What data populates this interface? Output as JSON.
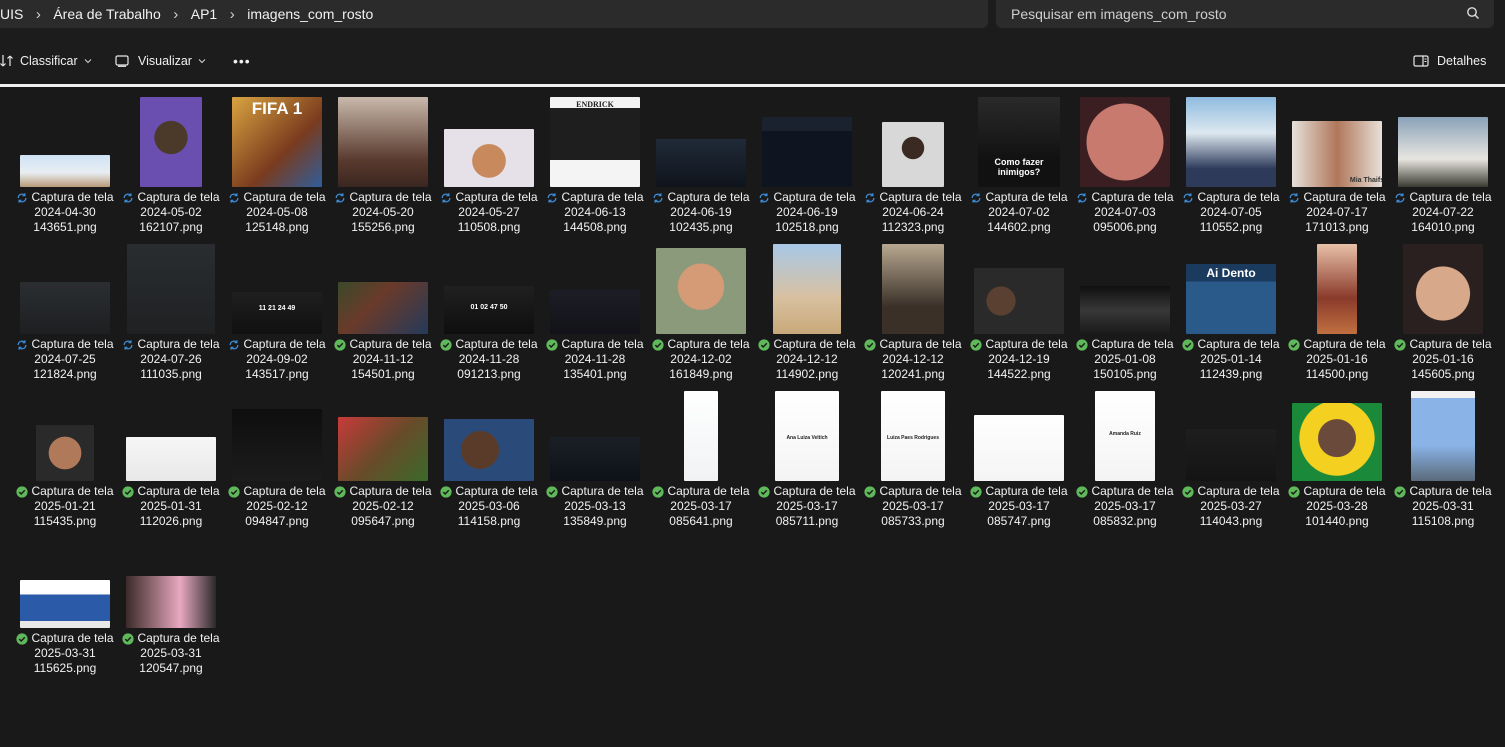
{
  "breadcrumb": {
    "items": [
      "UIS",
      "Área de Trabalho",
      "AP1",
      "imagens_com_rosto"
    ]
  },
  "search": {
    "placeholder": "Pesquisar em imagens_com_rosto"
  },
  "toolbar": {
    "sort_label": "Classificar",
    "view_label": "Visualizar",
    "more_label": "•••",
    "details_label": "Detalhes"
  },
  "colors": {
    "sync_blue": "#3b8ed8",
    "synced_green": "#5fb85a",
    "background": "#191919",
    "bar": "#2b2b2b"
  },
  "files": [
    {
      "line1": "Captura de tela",
      "line2": "2024-04-30",
      "line3": "143651.png",
      "status": "syncing",
      "thumb_text": ""
    },
    {
      "line1": "Captura de tela",
      "line2": "2024-05-02",
      "line3": "162107.png",
      "status": "syncing",
      "thumb_text": ""
    },
    {
      "line1": "Captura de tela",
      "line2": "2024-05-08",
      "line3": "125148.png",
      "status": "syncing",
      "thumb_text": "FIFA 1"
    },
    {
      "line1": "Captura de tela",
      "line2": "2024-05-20",
      "line3": "155256.png",
      "status": "syncing",
      "thumb_text": ""
    },
    {
      "line1": "Captura de tela",
      "line2": "2024-05-27",
      "line3": "110508.png",
      "status": "syncing",
      "thumb_text": ""
    },
    {
      "line1": "Captura de tela",
      "line2": "2024-06-13",
      "line3": "144508.png",
      "status": "syncing",
      "thumb_text": "ENDRICK"
    },
    {
      "line1": "Captura de tela",
      "line2": "2024-06-19",
      "line3": "102435.png",
      "status": "syncing",
      "thumb_text": ""
    },
    {
      "line1": "Captura de tela",
      "line2": "2024-06-19",
      "line3": "102518.png",
      "status": "syncing",
      "thumb_text": ""
    },
    {
      "line1": "Captura de tela",
      "line2": "2024-06-24",
      "line3": "112323.png",
      "status": "syncing",
      "thumb_text": ""
    },
    {
      "line1": "Captura de tela",
      "line2": "2024-07-02",
      "line3": "144602.png",
      "status": "syncing",
      "thumb_text": "Como fazer inimigos?"
    },
    {
      "line1": "Captura de tela",
      "line2": "2024-07-03",
      "line3": "095006.png",
      "status": "syncing",
      "thumb_text": ""
    },
    {
      "line1": "Captura de tela",
      "line2": "2024-07-05",
      "line3": "110552.png",
      "status": "syncing",
      "thumb_text": ""
    },
    {
      "line1": "Captura de tela",
      "line2": "2024-07-17",
      "line3": "171013.png",
      "status": "syncing",
      "thumb_text": "Mia Thaifs"
    },
    {
      "line1": "Captura de tela",
      "line2": "2024-07-22",
      "line3": "164010.png",
      "status": "syncing",
      "thumb_text": ""
    },
    {
      "line1": "Captura de tela",
      "line2": "2024-07-25",
      "line3": "121824.png",
      "status": "syncing",
      "thumb_text": ""
    },
    {
      "line1": "Captura de tela",
      "line2": "2024-07-26",
      "line3": "111035.png",
      "status": "syncing",
      "thumb_text": ""
    },
    {
      "line1": "Captura de tela",
      "line2": "2024-09-02",
      "line3": "143517.png",
      "status": "syncing",
      "thumb_text": "11 21 24 49"
    },
    {
      "line1": "Captura de tela",
      "line2": "2024-11-12",
      "line3": "154501.png",
      "status": "synced",
      "thumb_text": ""
    },
    {
      "line1": "Captura de tela",
      "line2": "2024-11-28",
      "line3": "091213.png",
      "status": "synced",
      "thumb_text": "01 02 47 50"
    },
    {
      "line1": "Captura de tela",
      "line2": "2024-11-28",
      "line3": "135401.png",
      "status": "synced",
      "thumb_text": ""
    },
    {
      "line1": "Captura de tela",
      "line2": "2024-12-02",
      "line3": "161849.png",
      "status": "synced",
      "thumb_text": ""
    },
    {
      "line1": "Captura de tela",
      "line2": "2024-12-12",
      "line3": "114902.png",
      "status": "synced",
      "thumb_text": ""
    },
    {
      "line1": "Captura de tela",
      "line2": "2024-12-12",
      "line3": "120241.png",
      "status": "synced",
      "thumb_text": ""
    },
    {
      "line1": "Captura de tela",
      "line2": "2024-12-19",
      "line3": "144522.png",
      "status": "synced",
      "thumb_text": ""
    },
    {
      "line1": "Captura de tela",
      "line2": "2025-01-08",
      "line3": "150105.png",
      "status": "synced",
      "thumb_text": ""
    },
    {
      "line1": "Captura de tela",
      "line2": "2025-01-14",
      "line3": "112439.png",
      "status": "synced",
      "thumb_text": "Ai Dento"
    },
    {
      "line1": "Captura de tela",
      "line2": "2025-01-16",
      "line3": "114500.png",
      "status": "synced",
      "thumb_text": ""
    },
    {
      "line1": "Captura de tela",
      "line2": "2025-01-16",
      "line3": "145605.png",
      "status": "synced",
      "thumb_text": ""
    },
    {
      "line1": "Captura de tela",
      "line2": "2025-01-21",
      "line3": "115435.png",
      "status": "synced",
      "thumb_text": ""
    },
    {
      "line1": "Captura de tela",
      "line2": "2025-01-31",
      "line3": "112026.png",
      "status": "synced",
      "thumb_text": ""
    },
    {
      "line1": "Captura de tela",
      "line2": "2025-02-12",
      "line3": "094847.png",
      "status": "synced",
      "thumb_text": ""
    },
    {
      "line1": "Captura de tela",
      "line2": "2025-02-12",
      "line3": "095647.png",
      "status": "synced",
      "thumb_text": ""
    },
    {
      "line1": "Captura de tela",
      "line2": "2025-03-06",
      "line3": "114158.png",
      "status": "synced",
      "thumb_text": ""
    },
    {
      "line1": "Captura de tela",
      "line2": "2025-03-13",
      "line3": "135849.png",
      "status": "synced",
      "thumb_text": ""
    },
    {
      "line1": "Captura de tela",
      "line2": "2025-03-17",
      "line3": "085641.png",
      "status": "synced",
      "thumb_text": ""
    },
    {
      "line1": "Captura de tela",
      "line2": "2025-03-17",
      "line3": "085711.png",
      "status": "synced",
      "thumb_text": "Ana Luiza Veltich"
    },
    {
      "line1": "Captura de tela",
      "line2": "2025-03-17",
      "line3": "085733.png",
      "status": "synced",
      "thumb_text": "Luiza Paes Rodrigues"
    },
    {
      "line1": "Captura de tela",
      "line2": "2025-03-17",
      "line3": "085747.png",
      "status": "synced",
      "thumb_text": ""
    },
    {
      "line1": "Captura de tela",
      "line2": "2025-03-17",
      "line3": "085832.png",
      "status": "synced",
      "thumb_text": "Amanda Ruiz"
    },
    {
      "line1": "Captura de tela",
      "line2": "2025-03-27",
      "line3": "114043.png",
      "status": "synced",
      "thumb_text": ""
    },
    {
      "line1": "Captura de tela",
      "line2": "2025-03-28",
      "line3": "101440.png",
      "status": "synced",
      "thumb_text": ""
    },
    {
      "line1": "Captura de tela",
      "line2": "2025-03-31",
      "line3": "115108.png",
      "status": "synced",
      "thumb_text": ""
    },
    {
      "line1": "Captura de tela",
      "line2": "2025-03-31",
      "line3": "115625.png",
      "status": "synced",
      "thumb_text": ""
    },
    {
      "line1": "Captura de tela",
      "line2": "2025-03-31",
      "line3": "120547.png",
      "status": "synced",
      "thumb_text": ""
    }
  ]
}
